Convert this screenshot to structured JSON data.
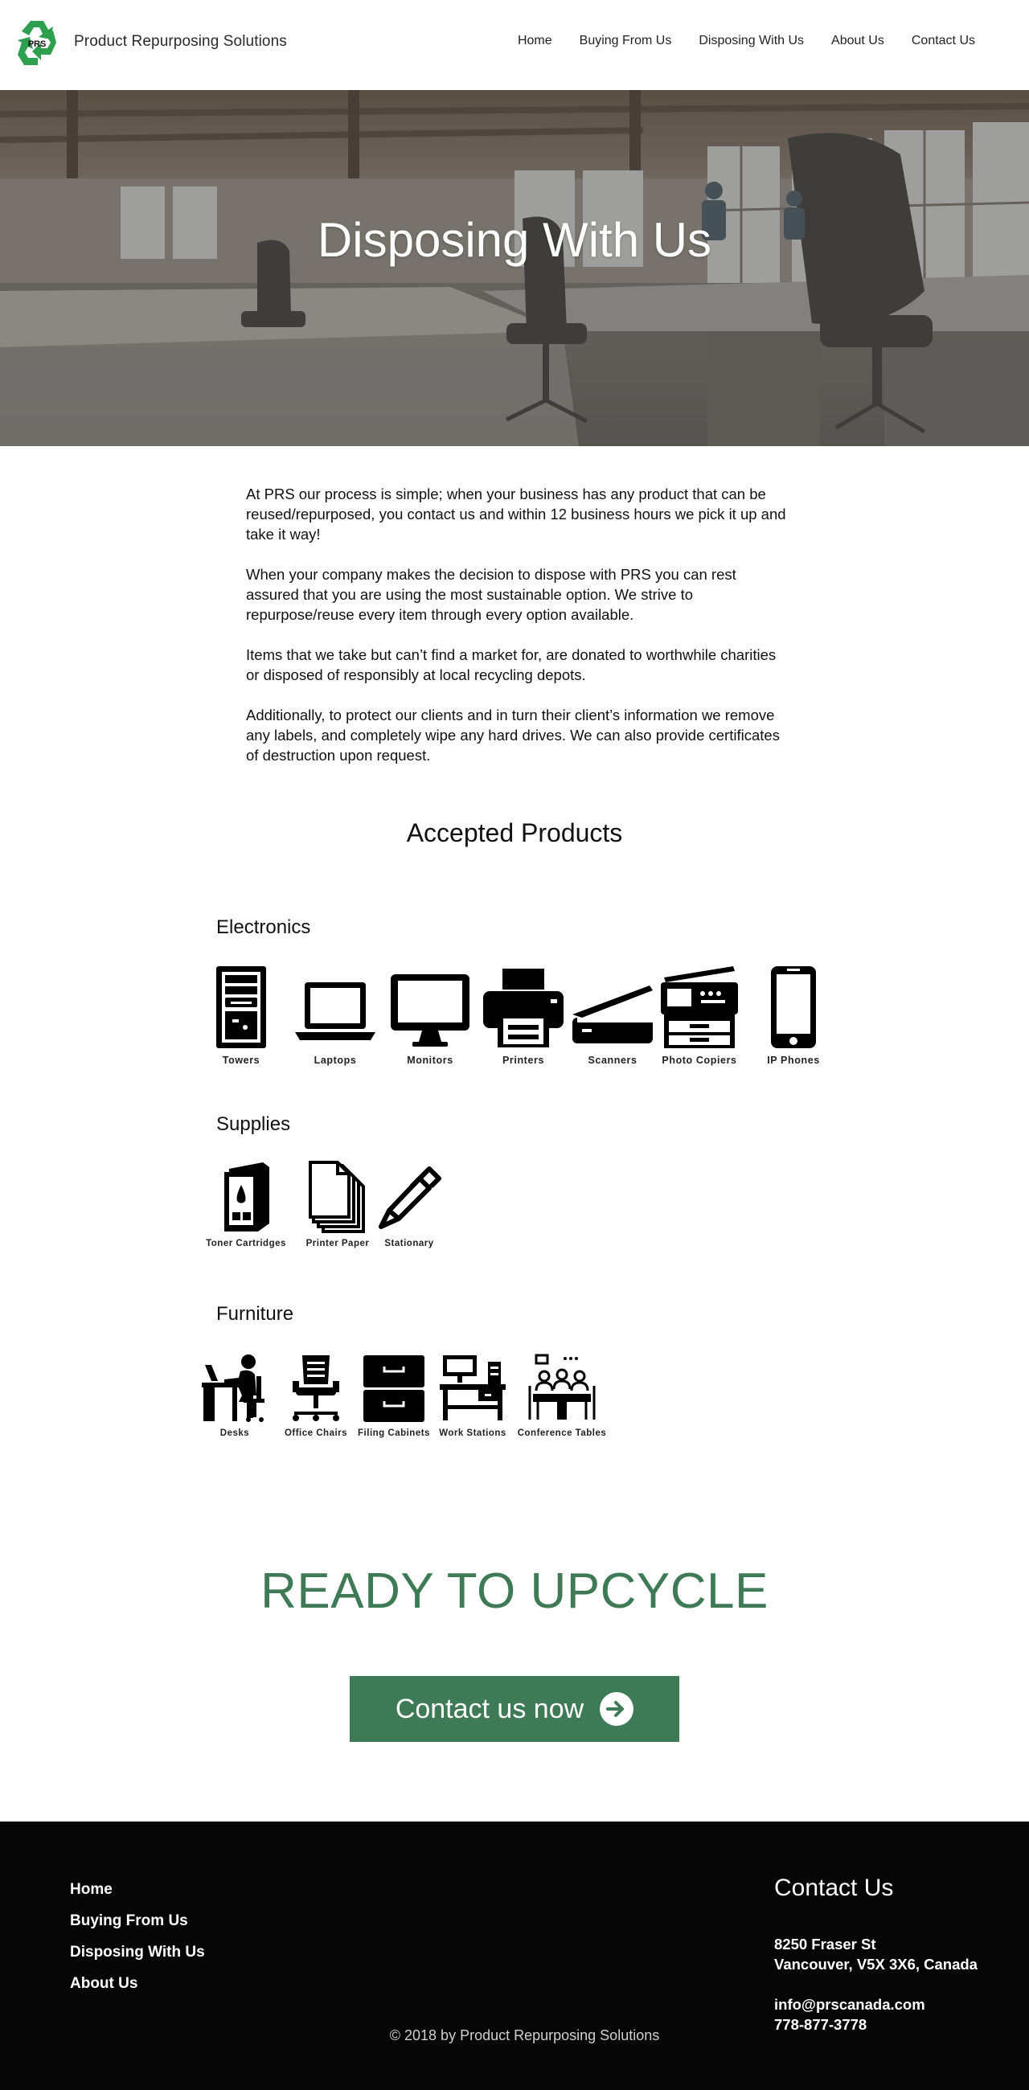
{
  "header": {
    "logo_text": "PRS",
    "brand_name": "Product Repurposing Solutions",
    "nav": [
      "Home",
      "Buying From Us",
      "Disposing With Us",
      "About Us",
      "Contact Us"
    ]
  },
  "hero": {
    "title": "Disposing With Us"
  },
  "intro": {
    "paragraphs": [
      "At PRS our process is simple; when your business has any product that can be reused/repurposed, you contact us and within 12 business hours we pick it up and take it way!",
      "When your company makes the decision to dispose with PRS you can rest assured that you are using the most sustainable option. We strive to repurpose/reuse every item through every option available.",
      "Items that we take but can’t find a market for, are donated to worthwhile charities or disposed of responsibly at local recycling depots.",
      "Additionally, to protect our clients and in turn their client’s information we remove any labels, and completely wipe any hard drives. We can also provide certificates of destruction upon request."
    ]
  },
  "products": {
    "title": "Accepted Products",
    "categories": [
      {
        "name": "Electronics",
        "items": [
          {
            "label": "Towers",
            "icon": "server-tower-icon"
          },
          {
            "label": "Laptops",
            "icon": "laptop-icon"
          },
          {
            "label": "Monitors",
            "icon": "monitor-icon"
          },
          {
            "label": "Printers",
            "icon": "printer-icon"
          },
          {
            "label": "Scanners",
            "icon": "scanner-icon"
          },
          {
            "label": "Photo Copiers",
            "icon": "photocopier-icon"
          },
          {
            "label": "IP Phones",
            "icon": "phone-icon"
          }
        ]
      },
      {
        "name": "Supplies",
        "items": [
          {
            "label": "Toner Cartridges",
            "icon": "toner-cartridge-icon"
          },
          {
            "label": "Printer Paper",
            "icon": "paper-stack-icon"
          },
          {
            "label": "Stationary",
            "icon": "pen-icon"
          }
        ]
      },
      {
        "name": "Furniture",
        "items": [
          {
            "label": "Desks",
            "icon": "desk-icon"
          },
          {
            "label": "Office Chairs",
            "icon": "office-chair-icon"
          },
          {
            "label": "Filing Cabinets",
            "icon": "filing-cabinet-icon"
          },
          {
            "label": "Work Stations",
            "icon": "workstation-icon"
          },
          {
            "label": "Conference Tables",
            "icon": "conference-table-icon"
          }
        ]
      }
    ]
  },
  "cta": {
    "title": "READY TO UPCYCLE",
    "button_label": "Contact us now",
    "button_icon": "arrow-right-icon"
  },
  "footer": {
    "nav": [
      "Home",
      "Buying From Us",
      "Disposing With Us",
      "About Us"
    ],
    "contact_title": "Contact Us",
    "address_line1": "8250 Fraser St",
    "address_line2": "Vancouver, V5X 3X6, Canada",
    "email": "info@prscanada.com",
    "phone": "778-877-3778",
    "copyright": "© 2018  by Product Repurposing Solutions"
  },
  "colors": {
    "brand_green": "#3f7a56",
    "logo_green": "#2e9e4f",
    "footer_bg": "#060606"
  }
}
